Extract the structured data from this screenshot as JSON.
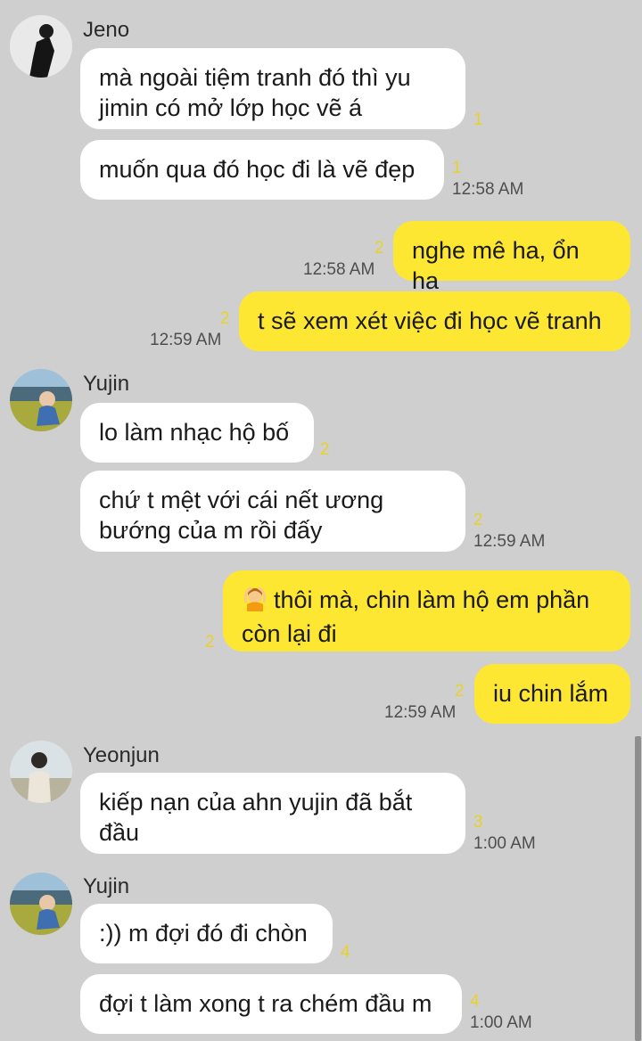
{
  "messages": [
    {
      "sender": "Jeno",
      "text": "mà ngoài tiệm tranh đó thì yu\njimin  có mở lớp học vẽ á",
      "unread": "1"
    },
    {
      "text": "muốn qua đó học đi là vẽ đẹp",
      "unread": "1",
      "time": "12:58 AM"
    },
    {
      "text": "nghe mê ha, ổn ha",
      "unread": "2",
      "time": "12:58 AM"
    },
    {
      "text": "t sẽ xem xét việc đi học vẽ tranh",
      "unread": "2",
      "time": "12:59 AM"
    },
    {
      "sender": "Yujin",
      "text": "lo làm nhạc hộ bố",
      "unread": "2"
    },
    {
      "text": "chứ t mệt với cái nết ương\nbướng của m rồi đấy",
      "unread": "2",
      "time": "12:59 AM"
    },
    {
      "emoji": "woman-gesturing-ok-emoji",
      "text": "thôi mà, chin làm hộ em phần\ncòn lại đi",
      "unread": "2"
    },
    {
      "text": "iu chin lắm",
      "unread": "2",
      "time": "12:59 AM"
    },
    {
      "sender": "Yeonjun",
      "text": "kiếp nạn của ahn yujin đã bắt\nđầu",
      "unread": "3",
      "time": "1:00 AM"
    },
    {
      "sender": "Yujin",
      "text": ":)) m đợi đó đi chòn",
      "unread": "4"
    },
    {
      "text": "đợi t làm xong t ra chém đầu m",
      "unread": "4",
      "time": "1:00 AM"
    }
  ],
  "colors": {
    "background": "#cfcfcf",
    "incoming_bubble": "#ffffff",
    "outgoing_bubble": "#fee732",
    "unread_count": "#e8d22a",
    "timestamp": "#4e4e4e"
  }
}
